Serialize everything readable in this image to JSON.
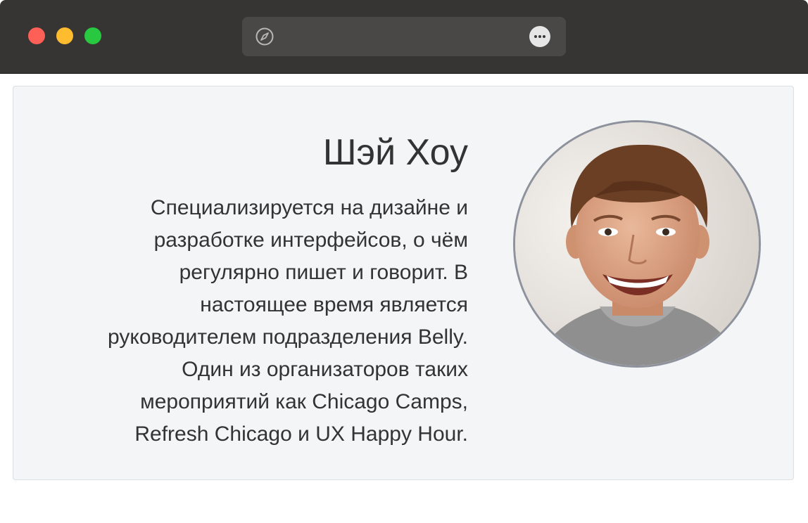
{
  "window": {
    "traffic_lights": {
      "close": "#fe5f57",
      "minimize": "#febc2e",
      "maximize": "#28c840"
    },
    "address_bar": {
      "url": "",
      "left_icon": "compass-icon",
      "right_icon": "more-options-icon"
    }
  },
  "profile": {
    "name": "Шэй Хоу",
    "bio": "Специализируется на дизайне и\nразработке интерфейсов, о чём\nрегулярно пишет и говорит. В\nнастоящее время является\nруководителем подразделения Belly.\nОдин из организаторов таких\nмероприятий как Chicago Camps,\nRefresh Chicago и UX Happy Hour.",
    "photo": "portrait-photo"
  }
}
